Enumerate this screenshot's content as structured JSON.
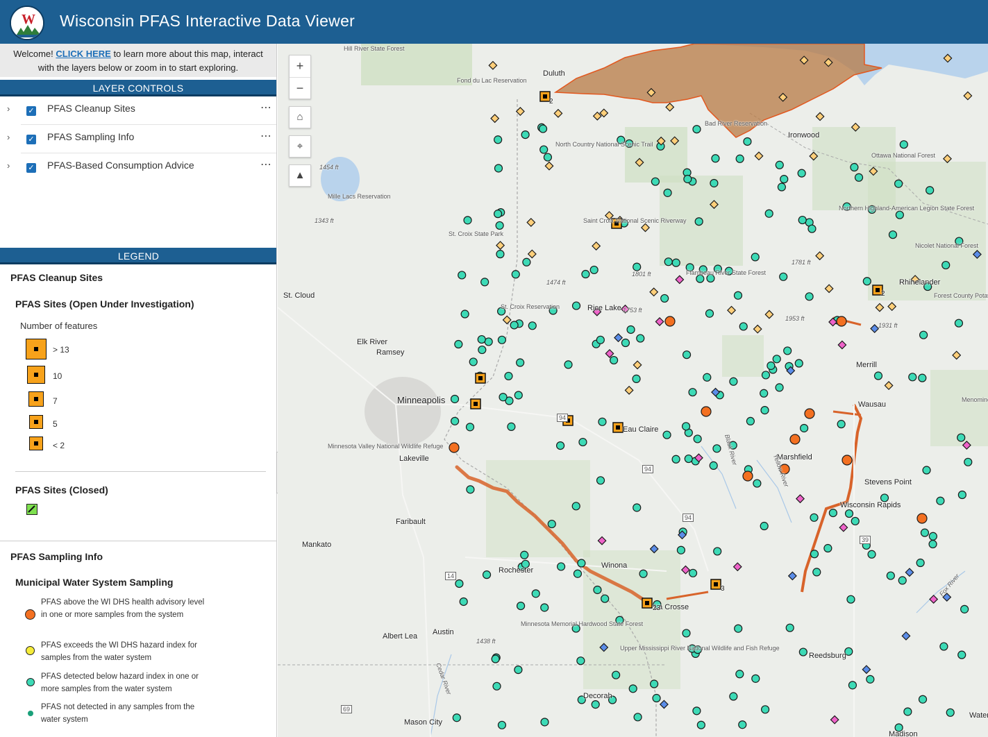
{
  "header": {
    "title": "Wisconsin PFAS Interactive Data Viewer"
  },
  "welcome": {
    "prefix": "Welcome! ",
    "link": "CLICK HERE",
    "suffix": " to learn more about this map, interact with the layers below or zoom in to start exploring."
  },
  "layer_controls": {
    "title": "LAYER CONTROLS",
    "layers": [
      {
        "label": "PFAS Cleanup Sites",
        "checked": true
      },
      {
        "label": "PFAS Sampling Info",
        "checked": true
      },
      {
        "label": "PFAS-Based Consumption Advice",
        "checked": true
      }
    ]
  },
  "legend": {
    "title": "LEGEND",
    "cleanup_title": "PFAS Cleanup Sites",
    "open_title": "PFAS Sites (Open Under Investigation)",
    "count_label": "Number of features",
    "counts": [
      "> 13",
      "10",
      "7",
      "5",
      "< 2"
    ],
    "closed_title": "PFAS Sites (Closed)",
    "sampling_title": "PFAS Sampling Info",
    "municipal_title": "Municipal Water System Sampling",
    "municipal_items": [
      {
        "label": "PFAS above the WI DHS health advisory level in one or more samples from the system",
        "color": "#f37021"
      },
      {
        "label": "PFAS exceeds the WI DHS hazard index for samples from the water system",
        "color": "#f5ec3a"
      },
      {
        "label": "PFAS detected below hazard index in one or more samples from the water system",
        "color": "#3ddab6"
      },
      {
        "label": "PFAS not detected in any samples from the water system",
        "color": "#1aa07a"
      }
    ]
  },
  "map": {
    "labels": {
      "hill_river": "Hill River State Forest",
      "fond_du_lac": "Fond du Lac Reservation",
      "duluth": "Duluth",
      "bad_river": "Bad River Reservation",
      "ironwood": "Ironwood",
      "ottawa": "Ottawa National Forest",
      "north_country": "North Country National Scenic Trail",
      "mille_lacs": "Mille Lacs Reservation",
      "elev_1454": "1454 ft",
      "elev_1343": "1343 ft",
      "st_croix_sp": "St. Croix State Park",
      "saint_croix_nsr": "Saint Croix National Scenic Riverway",
      "northern_highland": "Northern Highland-American Legion State Forest",
      "nicolet": "Nicolet National Forest",
      "flambeau": "Flambeau River State Forest",
      "elev_1781": "1781 ft",
      "elev_1474": "1474 ft",
      "elev_1801": "1801 ft",
      "st_cloud": "St. Cloud",
      "st_croix_res": "St. Croix Reservation",
      "rice_lake": "Rice Lake",
      "elev_1753": "1753 ft",
      "elev_1953": "1953 ft",
      "elev_1931": "1931 ft",
      "forest_county": "Forest County Potawatomi Community",
      "rhinelander": "Rhinelander",
      "elk_river": "Elk River",
      "ramsey": "Ramsey",
      "merrill": "Merrill",
      "minneapolis": "Minneapolis",
      "eau_claire": "Eau Claire",
      "wausau": "Wausau",
      "menominee": "Menominee Reservation",
      "mn_valley": "Minnesota Valley National Wildlife Refuge",
      "lakeville": "Lakeville",
      "marshfield": "Marshfield",
      "black_river": "Black River",
      "yellow_river": "Yellow River",
      "stevens_point": "Stevens Point",
      "faribault": "Faribault",
      "wisconsin_rapids": "Wisconsin Rapids",
      "mankato": "Mankato",
      "winona": "Winona",
      "rochester": "Rochester",
      "la_crosse": "La Crosse",
      "mn_memorial": "Minnesota Memorial Hardwood State Forest",
      "albert_lea": "Albert Lea",
      "austin": "Austin",
      "elev_1438": "1438 ft",
      "upper_miss": "Upper Mississippi River National Wildlife and Fish Refuge",
      "reedsburg": "Reedsburg",
      "cedar_river": "Cedar River",
      "decorah": "Decorah",
      "mason_city": "Mason City",
      "madison": "Madison",
      "waterloo": "Water",
      "fox_river": "Fox River",
      "hwy_94": "94",
      "hwy_14": "14",
      "hwy_39": "39",
      "hwy_69": "69",
      "cluster_2a": "2",
      "cluster_2b": "2",
      "cluster_3": "3",
      "cluster_23": "23"
    },
    "colors": {
      "municipal_above": "#f37021",
      "municipal_detected": "#3ddab6",
      "advice_diamond": "#ffcf7a",
      "pink_diamond": "#ee63c9",
      "blue_diamond": "#5b8de8",
      "cleanup_square": "#f7a21b"
    }
  }
}
